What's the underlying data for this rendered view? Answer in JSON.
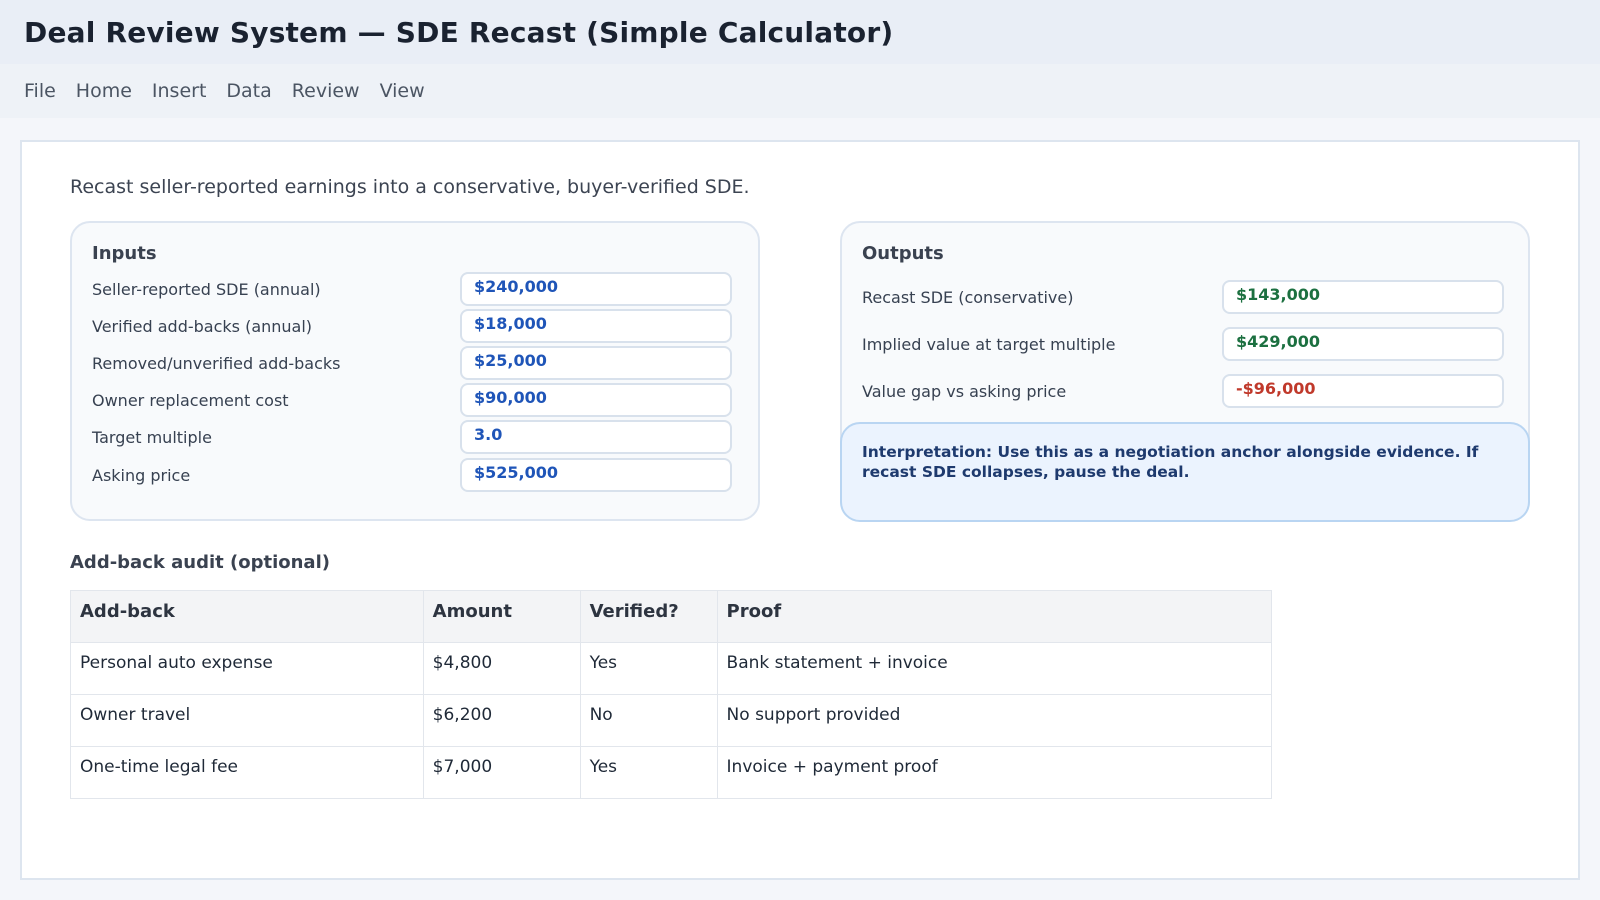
{
  "app": {
    "title": "Deal Review System — SDE Recast (Simple Calculator)"
  },
  "menu": [
    "File",
    "Home",
    "Insert",
    "Data",
    "Review",
    "View"
  ],
  "subtitle": "Recast seller-reported earnings into a conservative, buyer-verified SDE.",
  "inputs": {
    "heading": "Inputs",
    "rows": [
      {
        "label": "Seller-reported SDE (annual)",
        "value": "$240,000"
      },
      {
        "label": "Verified add-backs (annual)",
        "value": "$18,000"
      },
      {
        "label": "Removed/unverified add-backs",
        "value": "$25,000"
      },
      {
        "label": "Owner replacement cost",
        "value": "$90,000"
      },
      {
        "label": "Target multiple",
        "value": "3.0"
      },
      {
        "label": "Asking price",
        "value": "$525,000"
      }
    ]
  },
  "outputs": {
    "heading": "Outputs",
    "rows": [
      {
        "label": "Recast SDE (conservative)",
        "value": "$143,000"
      },
      {
        "label": "Implied value at target multiple",
        "value": "$429,000"
      },
      {
        "label": "Value gap vs asking price",
        "value": "-$96,000"
      }
    ],
    "note": "Interpretation: Use this as a negotiation anchor alongside evidence. If recast SDE collapses, pause the deal."
  },
  "audit": {
    "title": "Add-back audit (optional)",
    "columns": [
      "Add-back",
      "Amount",
      "Verified?",
      "Proof"
    ],
    "rows": [
      [
        "Personal auto expense",
        "$4,800",
        "Yes",
        "Bank statement + invoice"
      ],
      [
        "Owner travel",
        "$6,200",
        "No",
        "No support provided"
      ],
      [
        "One-time legal fee",
        "$7,000",
        "Yes",
        "Invoice + payment proof"
      ]
    ]
  },
  "colors": {
    "input_value": "#1f55b8",
    "positive_value": "#1c7040",
    "negative_value": "#c0392b"
  }
}
